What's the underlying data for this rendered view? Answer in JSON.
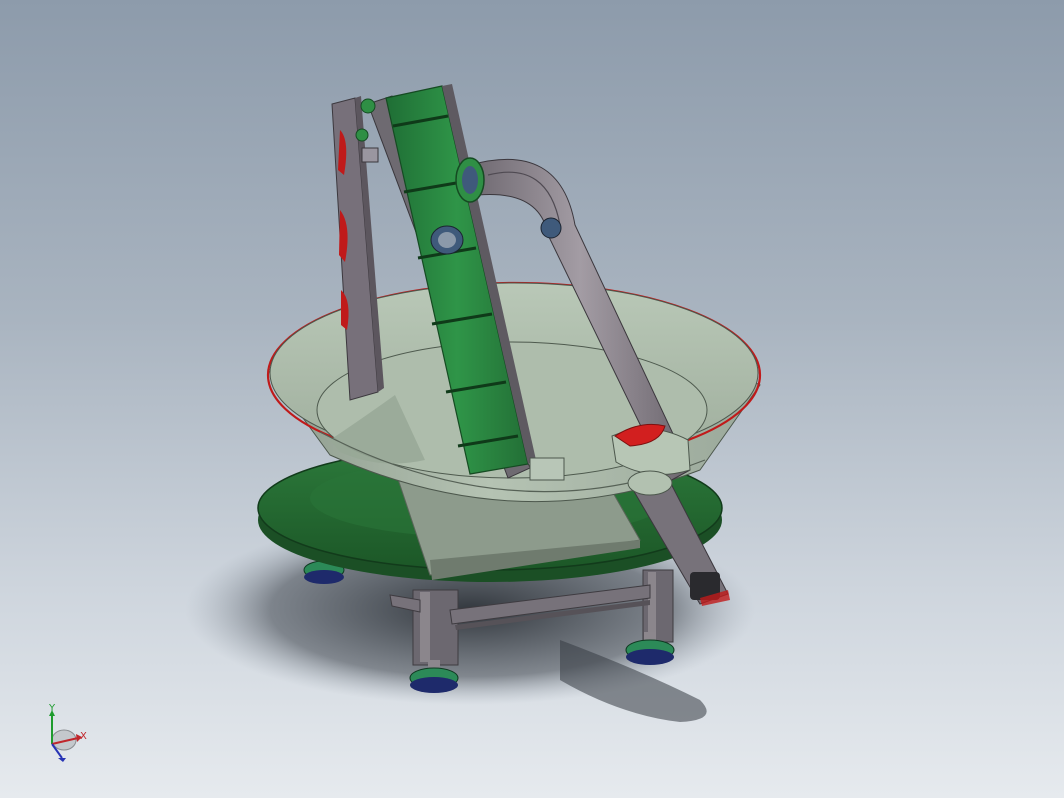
{
  "window": {
    "title": ""
  },
  "colors": {
    "background_top": "#8d9bab",
    "background_bottom": "#e6eaee",
    "bowl": "#a9b8a9",
    "bowl_inner": "#bccaba",
    "bowl_rim_edge": "#c01a1a",
    "base_disc": "#256b33",
    "conveyor_belt": "#2f8f45",
    "frame_metal": "#7a7279",
    "feet": "#2c8a58",
    "accent_red": "#d21f1f",
    "axis_x": "#c0262b",
    "axis_y": "#1e9c2e",
    "axis_z": "#2734b5"
  },
  "viewport": {
    "model_description_icons": [
      "vibratory-bowl-icon",
      "incline-conveyor-icon",
      "discharge-chute-icon",
      "base-platform-icon",
      "leveling-foot-icon"
    ]
  },
  "triad": {
    "x_label": "X",
    "y_label": "Y"
  }
}
